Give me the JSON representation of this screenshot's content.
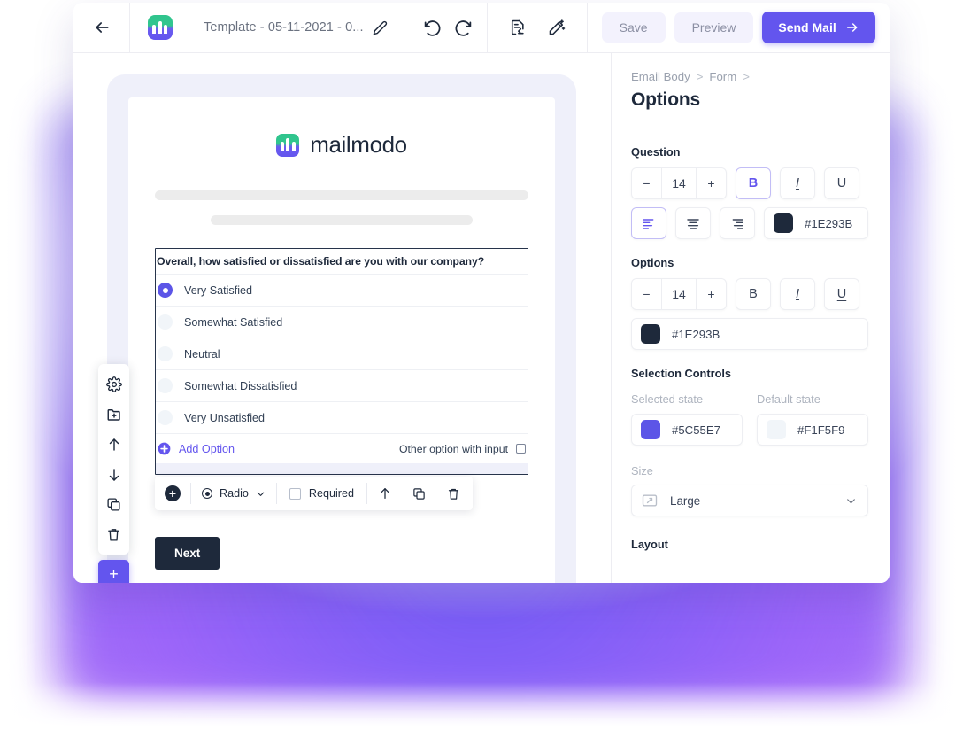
{
  "topbar": {
    "back_icon": "arrow-left-icon",
    "logo_icon": "mailmodo-logo-icon",
    "doc_title": "Template - 05-11-2021 - 0...",
    "edit_icon": "pencil-icon",
    "undo_icon": "undo-icon",
    "redo_icon": "redo-icon",
    "export_icon": "document-export-icon",
    "magic_icon": "magic-wand-icon",
    "save_label": "Save",
    "preview_label": "Preview",
    "send_label": "Send Mail",
    "send_arrow": "arrow-right-icon"
  },
  "float_toolbar": {
    "items": [
      {
        "icon": "gear-icon",
        "name": "settings"
      },
      {
        "icon": "folder-plus-icon",
        "name": "add-block"
      },
      {
        "icon": "arrow-up-icon",
        "name": "move-up"
      },
      {
        "icon": "arrow-down-icon",
        "name": "move-down"
      },
      {
        "icon": "copy-icon",
        "name": "duplicate"
      },
      {
        "icon": "trash-icon",
        "name": "delete"
      }
    ],
    "add_label": "+"
  },
  "email": {
    "brand_name": "mailmodo",
    "brand_logo_icon": "mailmodo-logo-icon",
    "skeleton_bars": 2,
    "form": {
      "question": "Overall, how satisfied or dissatisfied are you with our company?",
      "options": [
        {
          "label": "Very Satisfied",
          "selected": true
        },
        {
          "label": "Somewhat Satisfied",
          "selected": false
        },
        {
          "label": "Neutral",
          "selected": false
        },
        {
          "label": "Somewhat Dissatisfied",
          "selected": false
        },
        {
          "label": "Very Unsatisfied",
          "selected": false
        }
      ],
      "add_option_label": "Add Option",
      "other_option_label": "Other option with input",
      "other_option_checked": false
    },
    "toolbar": {
      "add_icon": "plus-circle-icon",
      "type_icon": "radio-icon",
      "type_label": "Radio",
      "type_caret": "chevron-down-icon",
      "required_label": "Required",
      "required_checked": false,
      "move_icon": "arrow-up-icon",
      "copy_icon": "copy-icon",
      "delete_icon": "trash-icon"
    },
    "next_label": "Next"
  },
  "panel": {
    "breadcrumb": [
      "Email Body",
      "Form"
    ],
    "breadcrumb_sep": ">",
    "title": "Options",
    "question_section": {
      "label": "Question",
      "font_size": "14",
      "minus": "−",
      "plus": "+",
      "bold": "B",
      "italic": "I",
      "underline": "U",
      "bold_active": true,
      "align_left_icon": "align-left-icon",
      "align_center_icon": "align-center-icon",
      "align_right_icon": "align-right-icon",
      "align_active": "left",
      "color_hex": "#1E293B"
    },
    "options_section": {
      "label": "Options",
      "font_size": "14",
      "minus": "−",
      "plus": "+",
      "bold": "B",
      "italic": "I",
      "underline": "U",
      "color_hex": "#1E293B"
    },
    "selection_controls": {
      "label": "Selection Controls",
      "selected_state_label": "Selected state",
      "selected_state_hex": "#5C55E7",
      "default_state_label": "Default state",
      "default_state_hex": "#F1F5F9"
    },
    "size": {
      "label": "Size",
      "value": "Large",
      "icon": "resize-icon",
      "caret": "chevron-down-icon"
    },
    "layout_label": "Layout"
  },
  "colors": {
    "accent": "#6355EE",
    "selected_state": "#5C55E7",
    "text_dark": "#1E293B",
    "default_state": "#F1F5F9",
    "canvas_bg": "#EFF0FA"
  }
}
